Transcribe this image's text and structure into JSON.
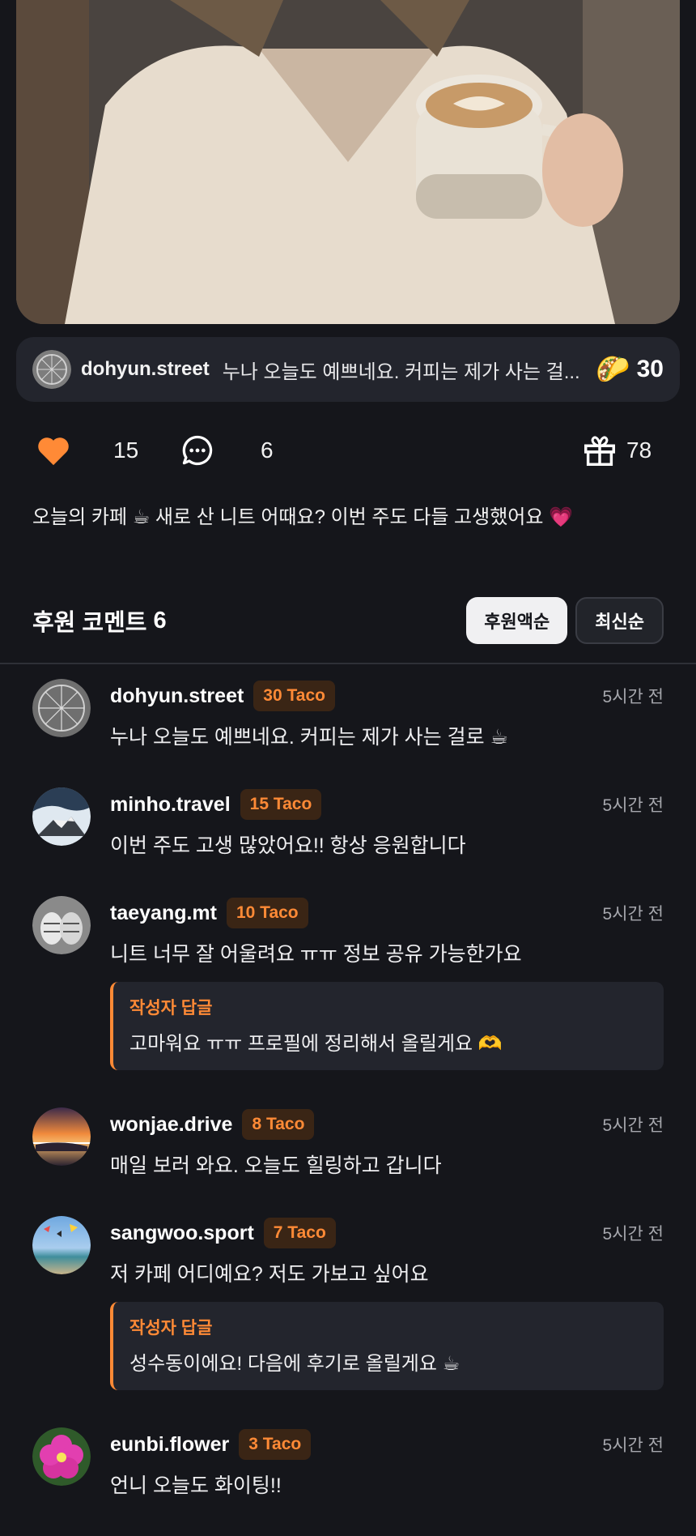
{
  "pinned": {
    "username": "dohyun.street",
    "message": "누나 오늘도 예쁘네요. 커피는 제가 사는 걸...",
    "taco_icon": "🌮",
    "amount": "30"
  },
  "actions": {
    "likes": "15",
    "comments": "6",
    "gifts": "78"
  },
  "caption": "오늘의 카페 ☕ 새로 산 니트 어때요? 이번 주도 다들 고생했어요 💗",
  "section": {
    "title": "후원 코멘트",
    "count": "6",
    "sort_donation": "후원액순",
    "sort_latest": "최신순"
  },
  "comments": [
    {
      "username": "dohyun.street",
      "badge": "30 Taco",
      "time": "5시간 전",
      "text": "누나 오늘도 예쁘네요. 커피는 제가 사는 걸로 ☕"
    },
    {
      "username": "minho.travel",
      "badge": "15 Taco",
      "time": "5시간 전",
      "text": "이번 주도 고생 많았어요!! 항상 응원합니다"
    },
    {
      "username": "taeyang.mt",
      "badge": "10 Taco",
      "time": "5시간 전",
      "text": "니트 너무 잘 어울려요 ㅠㅠ 정보 공유 가능한가요",
      "reply_label": "작성자 답글",
      "reply_text": "고마워요 ㅠㅠ 프로필에 정리해서 올릴게요 🫶"
    },
    {
      "username": "wonjae.drive",
      "badge": "8 Taco",
      "time": "5시간 전",
      "text": "매일 보러 와요. 오늘도 힐링하고 갑니다"
    },
    {
      "username": "sangwoo.sport",
      "badge": "7 Taco",
      "time": "5시간 전",
      "text": "저 카페 어디예요? 저도 가보고 싶어요",
      "reply_label": "작성자 답글",
      "reply_text": "성수동이에요! 다음에 후기로 올릴게요 ☕"
    },
    {
      "username": "eunbi.flower",
      "badge": "3 Taco",
      "time": "5시간 전",
      "text": "언니 오늘도 화이팅!!"
    }
  ],
  "colors": {
    "background": "#15161b",
    "accent": "#ff8a36",
    "card": "#23252d"
  }
}
